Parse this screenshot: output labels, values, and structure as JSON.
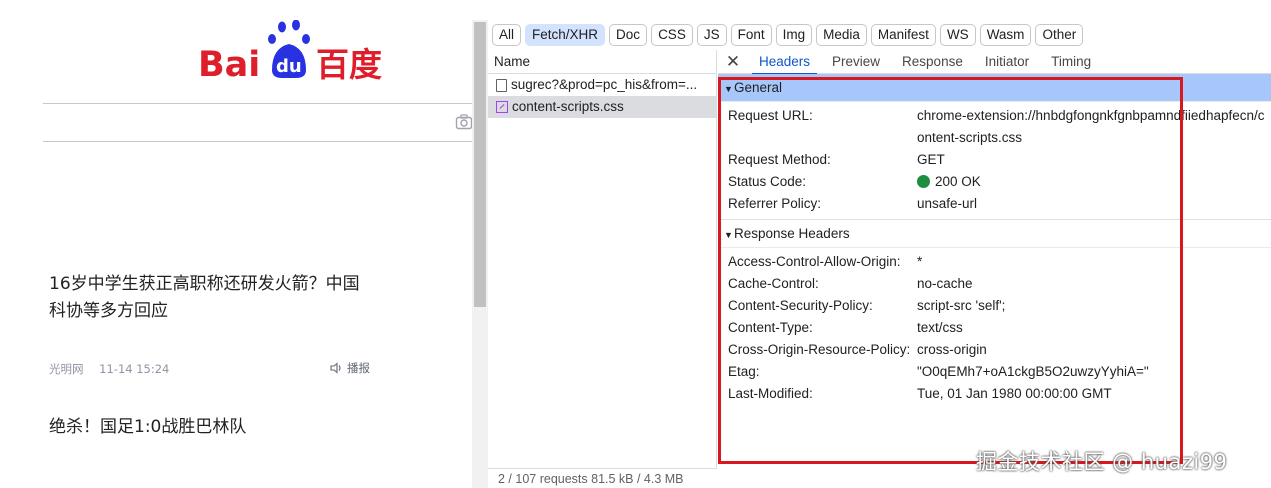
{
  "baidu": {
    "logo": {
      "left": "Bai",
      "paw": "du",
      "right": "百度"
    },
    "news": [
      {
        "title": "16岁中学生获正高职称还研发火箭？中国科协等多方回应",
        "source": "光明网",
        "time": "11-14 15:24",
        "action": "播报"
      },
      {
        "title": "绝杀！国足1:0战胜巴林队"
      }
    ]
  },
  "devtools": {
    "filters": [
      "All",
      "Fetch/XHR",
      "Doc",
      "CSS",
      "JS",
      "Font",
      "Img",
      "Media",
      "Manifest",
      "WS",
      "Wasm",
      "Other"
    ],
    "active_filter": "Fetch/XHR",
    "name_header": "Name",
    "requests": [
      {
        "name": "sugrec?&prod=pc_his&from=...",
        "icon": "document-icon"
      },
      {
        "name": "content-scripts.css",
        "icon": "css-file-icon"
      }
    ],
    "tabs": [
      "Headers",
      "Preview",
      "Response",
      "Initiator",
      "Timing"
    ],
    "active_tab": "Headers",
    "general": {
      "title": "General",
      "rows": [
        {
          "k": "Request URL:",
          "v": "chrome-extension://hnbdgfongnkfgnbpamndfiiedhapfecn/content-scripts.css"
        },
        {
          "k": "Request Method:",
          "v": "GET"
        },
        {
          "k": "Status Code:",
          "v": "200 OK"
        },
        {
          "k": "Referrer Policy:",
          "v": "unsafe-url"
        }
      ]
    },
    "response_headers": {
      "title": "Response Headers",
      "rows": [
        {
          "k": "Access-Control-Allow-Origin:",
          "v": "*"
        },
        {
          "k": "Cache-Control:",
          "v": "no-cache"
        },
        {
          "k": "Content-Security-Policy:",
          "v": "script-src 'self';"
        },
        {
          "k": "Content-Type:",
          "v": "text/css"
        },
        {
          "k": "Cross-Origin-Resource-Policy:",
          "v": "cross-origin"
        },
        {
          "k": "Etag:",
          "v": "\"O0qEMh7+oA1ckgB5O2uwzyYyhiA=\""
        },
        {
          "k": "Last-Modified:",
          "v": "Tue, 01 Jan 1980 00:00:00 GMT"
        }
      ]
    },
    "status_bar": "2 / 107 requests   81.5 kB / 4.3 MB",
    "colors": {
      "accent": "#0b57d0",
      "selected_section": "#a7c6fa",
      "status_ok": "#1e8e3e",
      "highlight": "#d8181e"
    }
  },
  "watermark": "掘金技术社区 @ huazi99"
}
